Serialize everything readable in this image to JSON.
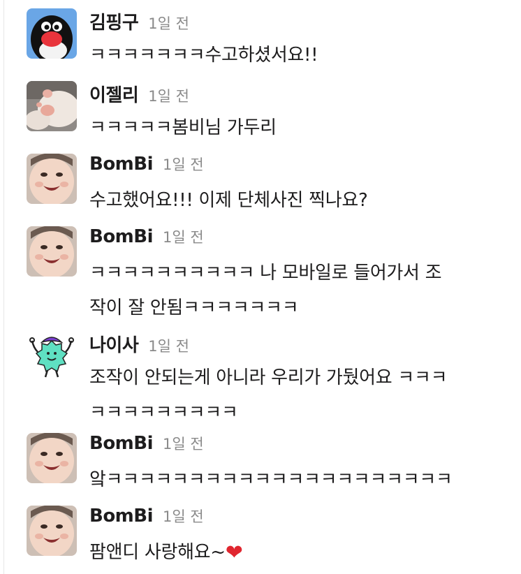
{
  "messages": [
    {
      "author": "김핑구",
      "time": "1일 전",
      "lines": [
        "ㅋㅋㅋㅋㅋㅋㅋ수고하셨서요!!"
      ],
      "avatar": "pingu-avatar"
    },
    {
      "author": "이젤리",
      "time": "1일 전",
      "lines": [
        "ㅋㅋㅋㅋㅋ봄비님 가두리"
      ],
      "avatar": "cat-paw-avatar"
    },
    {
      "author": "BomBi",
      "time": "1일 전",
      "lines": [
        "수고했어요!!! 이제 단체사진 찍나요?"
      ],
      "avatar": "baby-face-avatar"
    },
    {
      "author": "BomBi",
      "time": "1일 전",
      "lines": [
        "ㅋㅋㅋㅋㅋㅋㅋㅋㅋㅋ 나 모바일로 들어가서 조",
        "작이 잘 안됨ㅋㅋㅋㅋㅋㅋㅋ"
      ],
      "avatar": "baby-face-avatar"
    },
    {
      "author": "나이사",
      "time": "1일 전",
      "lines": [
        "조작이 안되는게 아니라 우리가 가뒀어요 ㅋㅋㅋ",
        "ㅋㅋㅋㅋㅋㅋㅋㅋㅋ"
      ],
      "avatar": "fuzzy-monster-avatar"
    },
    {
      "author": "BomBi",
      "time": "1일 전",
      "lines": [
        "앜ㅋㅋㅋㅋㅋㅋㅋㅋㅋㅋㅋㅋㅋㅋㅋㅋㅋㅋㅋㅋㅋ"
      ],
      "avatar": "baby-face-avatar"
    },
    {
      "author": "BomBi",
      "time": "1일 전",
      "lines": [
        "팜앤디 사랑해요~"
      ],
      "emoji": "❤",
      "avatar": "baby-face-avatar"
    }
  ],
  "colors": {
    "text": "#1d1c1d",
    "timestamp": "#8a8a8a",
    "heart": "#e0262f"
  }
}
